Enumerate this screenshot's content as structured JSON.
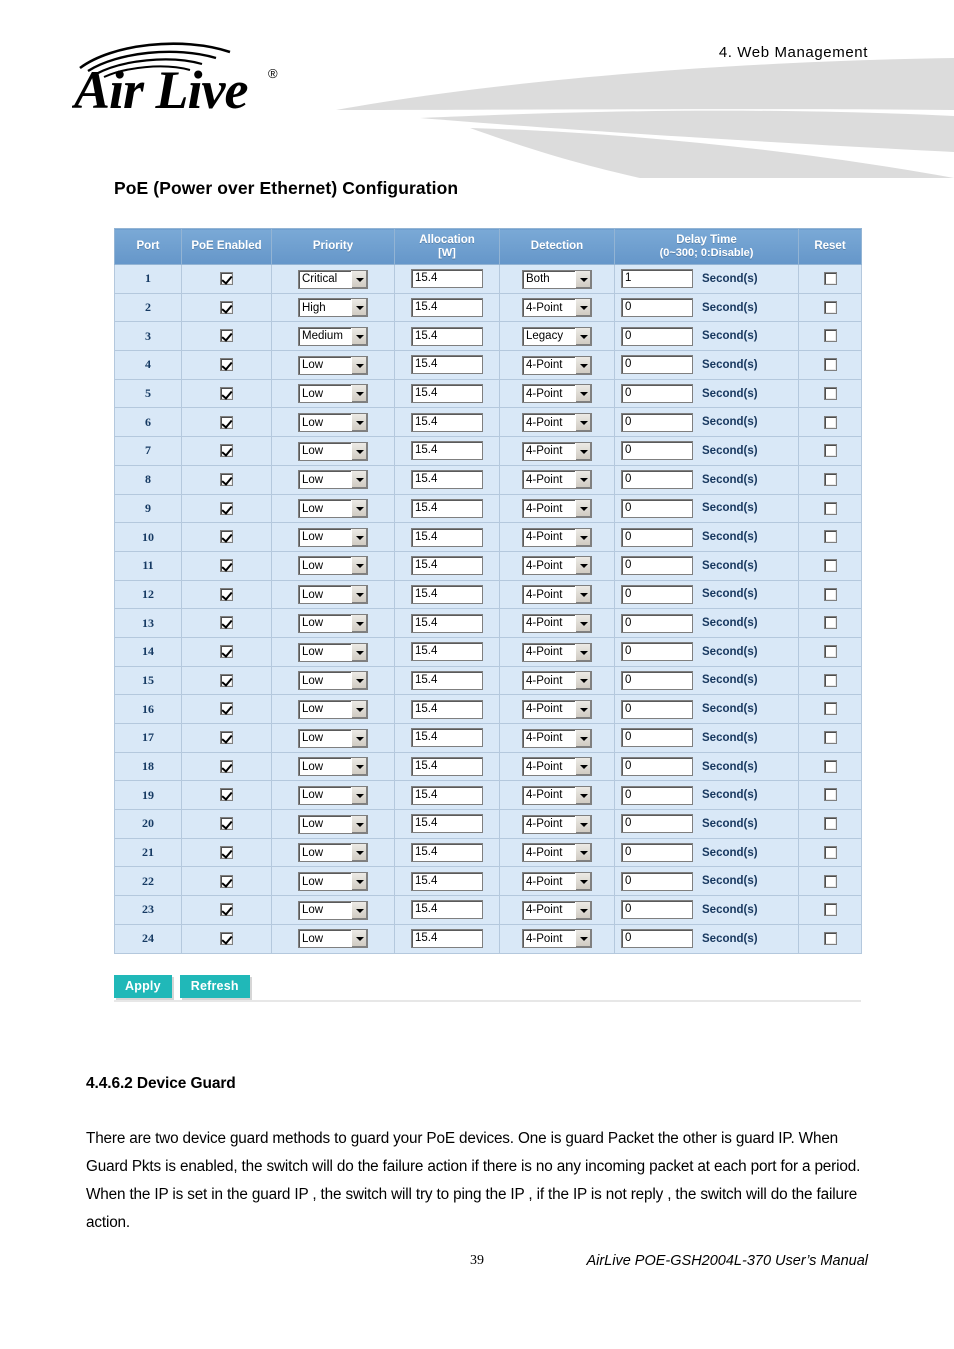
{
  "header": {
    "chapter": "4.  Web  Management",
    "logo_text": "Air Live",
    "logo_registered": "®"
  },
  "section": {
    "title": "PoE (Power over Ethernet) Configuration"
  },
  "table": {
    "columns": [
      {
        "key": "port",
        "label": "Port",
        "sub": ""
      },
      {
        "key": "enabled",
        "label": "PoE Enabled",
        "sub": ""
      },
      {
        "key": "priority",
        "label": "Priority",
        "sub": ""
      },
      {
        "key": "allocation",
        "label": "Allocation",
        "sub": "[W]"
      },
      {
        "key": "detection",
        "label": "Detection",
        "sub": ""
      },
      {
        "key": "delay",
        "label": "Delay Time",
        "sub": "(0~300; 0:Disable)"
      },
      {
        "key": "reset",
        "label": "Reset",
        "sub": ""
      }
    ],
    "delay_unit": "Second(s)",
    "priority_options": [
      "Critical",
      "High",
      "Medium",
      "Low"
    ],
    "detection_options": [
      "Both",
      "4-Point",
      "Legacy"
    ],
    "rows": [
      {
        "port": "1",
        "enabled": true,
        "priority": "Critical",
        "allocation": "15.4",
        "detection": "Both",
        "delay": "1",
        "reset": false
      },
      {
        "port": "2",
        "enabled": true,
        "priority": "High",
        "allocation": "15.4",
        "detection": "4-Point",
        "delay": "0",
        "reset": false
      },
      {
        "port": "3",
        "enabled": true,
        "priority": "Medium",
        "allocation": "15.4",
        "detection": "Legacy",
        "delay": "0",
        "reset": false
      },
      {
        "port": "4",
        "enabled": true,
        "priority": "Low",
        "allocation": "15.4",
        "detection": "4-Point",
        "delay": "0",
        "reset": false
      },
      {
        "port": "5",
        "enabled": true,
        "priority": "Low",
        "allocation": "15.4",
        "detection": "4-Point",
        "delay": "0",
        "reset": false
      },
      {
        "port": "6",
        "enabled": true,
        "priority": "Low",
        "allocation": "15.4",
        "detection": "4-Point",
        "delay": "0",
        "reset": false
      },
      {
        "port": "7",
        "enabled": true,
        "priority": "Low",
        "allocation": "15.4",
        "detection": "4-Point",
        "delay": "0",
        "reset": false
      },
      {
        "port": "8",
        "enabled": true,
        "priority": "Low",
        "allocation": "15.4",
        "detection": "4-Point",
        "delay": "0",
        "reset": false
      },
      {
        "port": "9",
        "enabled": true,
        "priority": "Low",
        "allocation": "15.4",
        "detection": "4-Point",
        "delay": "0",
        "reset": false
      },
      {
        "port": "10",
        "enabled": true,
        "priority": "Low",
        "allocation": "15.4",
        "detection": "4-Point",
        "delay": "0",
        "reset": false
      },
      {
        "port": "11",
        "enabled": true,
        "priority": "Low",
        "allocation": "15.4",
        "detection": "4-Point",
        "delay": "0",
        "reset": false
      },
      {
        "port": "12",
        "enabled": true,
        "priority": "Low",
        "allocation": "15.4",
        "detection": "4-Point",
        "delay": "0",
        "reset": false
      },
      {
        "port": "13",
        "enabled": true,
        "priority": "Low",
        "allocation": "15.4",
        "detection": "4-Point",
        "delay": "0",
        "reset": false
      },
      {
        "port": "14",
        "enabled": true,
        "priority": "Low",
        "allocation": "15.4",
        "detection": "4-Point",
        "delay": "0",
        "reset": false
      },
      {
        "port": "15",
        "enabled": true,
        "priority": "Low",
        "allocation": "15.4",
        "detection": "4-Point",
        "delay": "0",
        "reset": false
      },
      {
        "port": "16",
        "enabled": true,
        "priority": "Low",
        "allocation": "15.4",
        "detection": "4-Point",
        "delay": "0",
        "reset": false
      },
      {
        "port": "17",
        "enabled": true,
        "priority": "Low",
        "allocation": "15.4",
        "detection": "4-Point",
        "delay": "0",
        "reset": false
      },
      {
        "port": "18",
        "enabled": true,
        "priority": "Low",
        "allocation": "15.4",
        "detection": "4-Point",
        "delay": "0",
        "reset": false
      },
      {
        "port": "19",
        "enabled": true,
        "priority": "Low",
        "allocation": "15.4",
        "detection": "4-Point",
        "delay": "0",
        "reset": false
      },
      {
        "port": "20",
        "enabled": true,
        "priority": "Low",
        "allocation": "15.4",
        "detection": "4-Point",
        "delay": "0",
        "reset": false
      },
      {
        "port": "21",
        "enabled": true,
        "priority": "Low",
        "allocation": "15.4",
        "detection": "4-Point",
        "delay": "0",
        "reset": false
      },
      {
        "port": "22",
        "enabled": true,
        "priority": "Low",
        "allocation": "15.4",
        "detection": "4-Point",
        "delay": "0",
        "reset": false
      },
      {
        "port": "23",
        "enabled": true,
        "priority": "Low",
        "allocation": "15.4",
        "detection": "4-Point",
        "delay": "0",
        "reset": false
      },
      {
        "port": "24",
        "enabled": true,
        "priority": "Low",
        "allocation": "15.4",
        "detection": "4-Point",
        "delay": "0",
        "reset": false
      }
    ]
  },
  "buttons": {
    "apply": "Apply",
    "refresh": "Refresh"
  },
  "content": {
    "sub_heading": "4.4.6.2 Device Guard",
    "paragraph": "There are two device guard methods to guard your PoE devices. One is guard Packet the other is guard IP. When Guard Pkts is enabled, the switch will do the failure action if there is no any incoming packet at each port for a period. When the IP is set in the guard IP , the switch will try to ping the IP , if the IP is not reply , the switch will do the failure action."
  },
  "footer": {
    "page_number": "39",
    "manual_title": "AirLive POE-GSH2004L-370 User’s Manual"
  },
  "colors": {
    "table_header": "#6e9fd0",
    "table_cell": "#d9e8f7",
    "button": "#20b8b8",
    "swoosh": "#dcdcdc",
    "port_text": "#163a63"
  }
}
